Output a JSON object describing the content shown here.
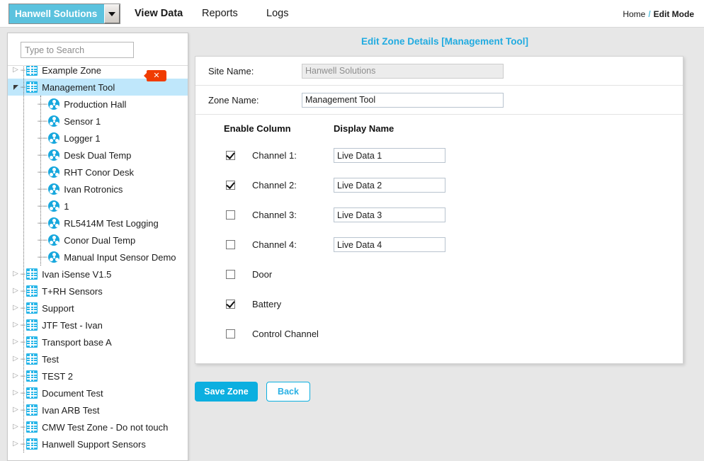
{
  "topnav": {
    "site_selector": {
      "value": "Hanwell Solutions",
      "dropdown_icon": "chevron-down-icon"
    },
    "tabs": [
      {
        "label": "View Data",
        "active": true
      },
      {
        "label": "Reports",
        "active": false
      },
      {
        "label": "Logs",
        "active": false
      }
    ],
    "breadcrumb": {
      "home": "Home",
      "separator": "/",
      "current": "Edit Mode"
    }
  },
  "sidebar": {
    "search": {
      "placeholder": "Type to Search",
      "value": ""
    },
    "clear_button": {
      "icon": "close-icon",
      "color": "#f03c02"
    },
    "tree": [
      {
        "label": "Example Zone",
        "type": "zone",
        "depth": 0,
        "state": "collapsed",
        "selected": false
      },
      {
        "label": "Management Tool",
        "type": "zone",
        "depth": 0,
        "state": "expanded",
        "selected": true
      },
      {
        "label": "Production Hall",
        "type": "sensor",
        "depth": 1,
        "state": "leaf",
        "selected": false
      },
      {
        "label": "Sensor 1",
        "type": "sensor",
        "depth": 1,
        "state": "leaf",
        "selected": false
      },
      {
        "label": "Logger 1",
        "type": "sensor",
        "depth": 1,
        "state": "leaf",
        "selected": false
      },
      {
        "label": "Desk Dual Temp",
        "type": "sensor",
        "depth": 1,
        "state": "leaf",
        "selected": false
      },
      {
        "label": "RHT Conor Desk",
        "type": "sensor",
        "depth": 1,
        "state": "leaf",
        "selected": false
      },
      {
        "label": "Ivan Rotronics",
        "type": "sensor",
        "depth": 1,
        "state": "leaf",
        "selected": false
      },
      {
        "label": "1",
        "type": "sensor",
        "depth": 1,
        "state": "leaf",
        "selected": false
      },
      {
        "label": "RL5414M Test Logging",
        "type": "sensor",
        "depth": 1,
        "state": "leaf",
        "selected": false
      },
      {
        "label": "Conor Dual Temp",
        "type": "sensor",
        "depth": 1,
        "state": "leaf",
        "selected": false
      },
      {
        "label": "Manual Input Sensor Demo",
        "type": "sensor",
        "depth": 1,
        "state": "leaf",
        "selected": false
      },
      {
        "label": "Ivan iSense V1.5",
        "type": "zone",
        "depth": 0,
        "state": "collapsed",
        "selected": false
      },
      {
        "label": "T+RH Sensors",
        "type": "zone",
        "depth": 0,
        "state": "collapsed",
        "selected": false
      },
      {
        "label": "Support",
        "type": "zone",
        "depth": 0,
        "state": "collapsed",
        "selected": false
      },
      {
        "label": "JTF Test - Ivan",
        "type": "zone",
        "depth": 0,
        "state": "collapsed",
        "selected": false
      },
      {
        "label": "Transport base A",
        "type": "zone",
        "depth": 0,
        "state": "collapsed",
        "selected": false
      },
      {
        "label": "Test",
        "type": "zone",
        "depth": 0,
        "state": "collapsed",
        "selected": false
      },
      {
        "label": "TEST 2",
        "type": "zone",
        "depth": 0,
        "state": "collapsed",
        "selected": false
      },
      {
        "label": "Document Test",
        "type": "zone",
        "depth": 0,
        "state": "collapsed",
        "selected": false
      },
      {
        "label": "Ivan ARB Test",
        "type": "zone",
        "depth": 0,
        "state": "collapsed",
        "selected": false
      },
      {
        "label": "CMW Test Zone - Do not touch",
        "type": "zone",
        "depth": 0,
        "state": "collapsed",
        "selected": false
      },
      {
        "label": "Hanwell Support Sensors",
        "type": "zone",
        "depth": 0,
        "state": "collapsed",
        "selected": false
      }
    ]
  },
  "main": {
    "title": "Edit Zone Details [Management Tool]",
    "fields": [
      {
        "label": "Site Name:",
        "value": "Hanwell Solutions",
        "disabled": true
      },
      {
        "label": "Zone Name:",
        "value": "Management Tool",
        "disabled": false
      }
    ],
    "channel_table": {
      "header_enable": "Enable Column",
      "header_display": "Display Name",
      "rows": [
        {
          "name": "Channel 1:",
          "checked": true,
          "display_name": "Live Data 1",
          "has_input": true
        },
        {
          "name": "Channel 2:",
          "checked": true,
          "display_name": "Live Data 2",
          "has_input": true
        },
        {
          "name": "Channel 3:",
          "checked": false,
          "display_name": "Live Data 3",
          "has_input": true
        },
        {
          "name": "Channel 4:",
          "checked": false,
          "display_name": "Live Data 4",
          "has_input": true
        },
        {
          "name": "Door",
          "checked": false,
          "display_name": "",
          "has_input": false
        },
        {
          "name": "Battery",
          "checked": true,
          "display_name": "",
          "has_input": false
        },
        {
          "name": "Control Channel",
          "checked": false,
          "display_name": "",
          "has_input": false
        }
      ]
    },
    "actions": {
      "save_label": "Save Zone",
      "back_label": "Back"
    }
  },
  "colors": {
    "accent": "#0cafe0",
    "title": "#21abe0",
    "selector_bg": "#5bc2de",
    "selection": "#bfe7fb",
    "close": "#f03c02"
  }
}
